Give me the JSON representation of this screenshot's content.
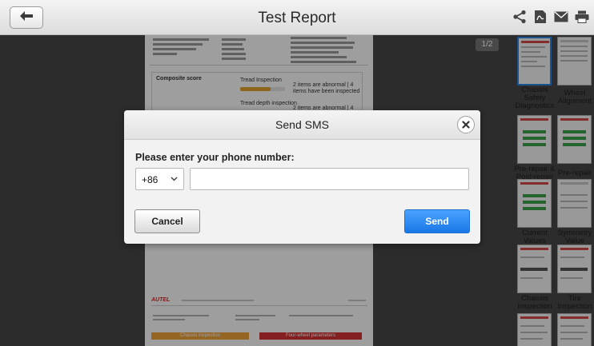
{
  "app": {
    "title": "Test Report",
    "accent_color": "#2a86e8",
    "toolbar_icons": [
      "share-icon",
      "pdf-icon",
      "mail-icon",
      "print-icon"
    ],
    "page_indicator": "1/2"
  },
  "report": {
    "composite_label": "Composite score",
    "tread_inspection": "Tread Inspection",
    "tread_note": "2 items are abnormal | 4 items have been inspected",
    "tread_depth": "Tread depth inspection",
    "tread_depth_note": "2 items are abnormal | 4",
    "brand": "AUTEL",
    "section_left": "Chassis inspection",
    "section_right": "Four-wheel parameters"
  },
  "thumbnails": [
    {
      "label": "Chassis Safety Diagnostics",
      "selected": true
    },
    {
      "label": "Wheel Alignment",
      "selected": false
    },
    {
      "label": "Pre-repair & Post-repair",
      "selected": false
    },
    {
      "label": "Pre-repair",
      "selected": false
    },
    {
      "label": "Current Values",
      "selected": false
    },
    {
      "label": "Symmetry Value",
      "selected": false
    },
    {
      "label": "Chassis Inspection",
      "selected": false
    },
    {
      "label": "Tire Inspection",
      "selected": false
    }
  ],
  "dialog": {
    "title": "Send SMS",
    "prompt": "Please enter your phone number:",
    "country_code": "+86",
    "phone_value": "",
    "cancel_label": "Cancel",
    "send_label": "Send",
    "send_color": "#1a78e6"
  }
}
